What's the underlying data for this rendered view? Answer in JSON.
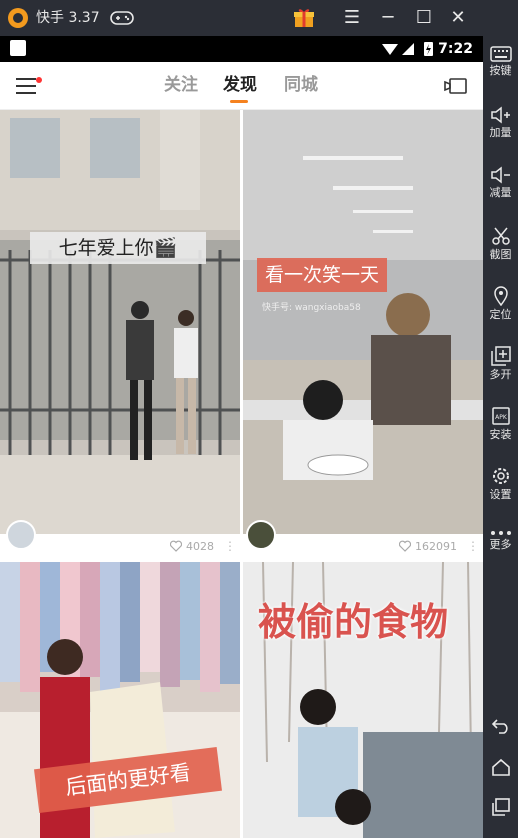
{
  "window": {
    "title": "快手 3.37"
  },
  "statusbar": {
    "time": "7:22"
  },
  "tabs": [
    {
      "label": "关注"
    },
    {
      "label": "发现"
    },
    {
      "label": "同城"
    }
  ],
  "accent_color": "#f5821f",
  "cards": [
    {
      "caption": "七年爱上你🎬",
      "likes": "4028"
    },
    {
      "caption": "看一次笑一天",
      "subcaption": "快手号: wangxiaoba58",
      "likes": "162091"
    },
    {
      "caption": "后面的更好看"
    },
    {
      "caption": "被偷的食物"
    }
  ],
  "sidebar": [
    {
      "icon": "keyboard-icon",
      "label": "按键"
    },
    {
      "icon": "volume-up-icon",
      "label": "加量"
    },
    {
      "icon": "volume-down-icon",
      "label": "减量"
    },
    {
      "icon": "scissors-icon",
      "label": "截图"
    },
    {
      "icon": "location-icon",
      "label": "定位"
    },
    {
      "icon": "multi-open-icon",
      "label": "多开"
    },
    {
      "icon": "apk-install-icon",
      "label": "安装"
    },
    {
      "icon": "gear-icon",
      "label": "设置"
    },
    {
      "icon": "more-dots-icon",
      "label": "更多"
    }
  ]
}
